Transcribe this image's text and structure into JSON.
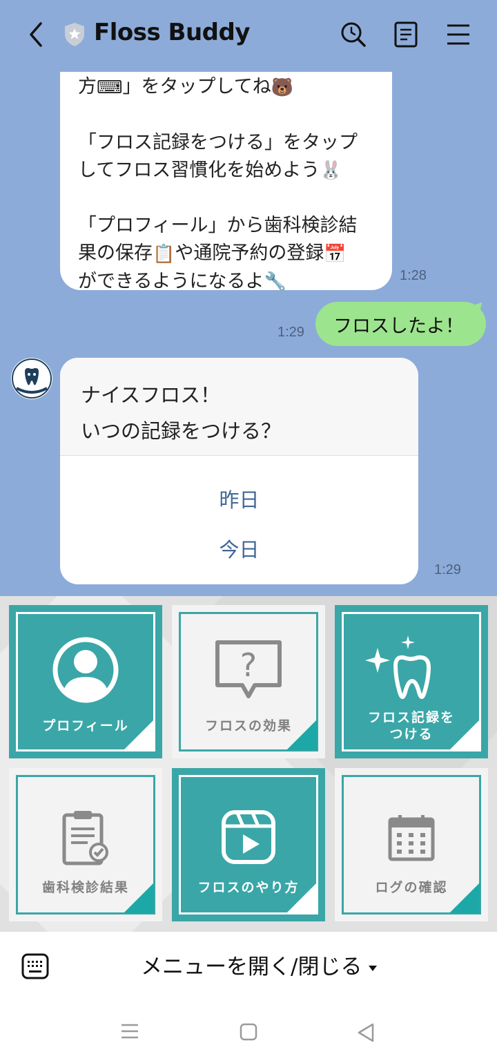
{
  "header": {
    "title": "Floss Buddy"
  },
  "messages": {
    "bot_message": {
      "line1_text": "方",
      "line1_tail": "」をタップしてね",
      "para2_line1": "「フロス記録をつける」をタップ",
      "para2_line2": "してフロス習慣化を始めよう",
      "para3_line1": "「プロフィール」から歯科検診結",
      "para3_line2a": "果の保存",
      "para3_line2b": "や通院予約の登録",
      "para3_line3": "ができるようになるよ",
      "time": "1:28"
    },
    "user_message": {
      "text": "フロスしたよ！",
      "time": "1:29"
    },
    "quick_reply_card": {
      "line1": "ナイスフロス！",
      "line2": "いつの記録をつける？",
      "options": [
        "昨日",
        "今日"
      ],
      "time": "1:29"
    }
  },
  "rich_menu": {
    "tiles": [
      {
        "label": "プロフィール",
        "icon": "profile-icon"
      },
      {
        "label": "フロスの効果",
        "icon": "question-bubble-icon"
      },
      {
        "label1": "フロス記録を",
        "label2": "つける",
        "icon": "sparkle-tooth-icon"
      },
      {
        "label": "歯科検診結果",
        "icon": "clipboard-check-icon"
      },
      {
        "label": "フロスのやり方",
        "icon": "video-play-icon"
      },
      {
        "label": "ログの確認",
        "icon": "calendar-icon"
      }
    ]
  },
  "menu_bar": {
    "toggle_label": "メニューを開く/閉じる"
  },
  "colors": {
    "chat_background": "#8cabd9",
    "user_bubble": "#9de48e",
    "menu_teal": "#3aa6a7"
  }
}
